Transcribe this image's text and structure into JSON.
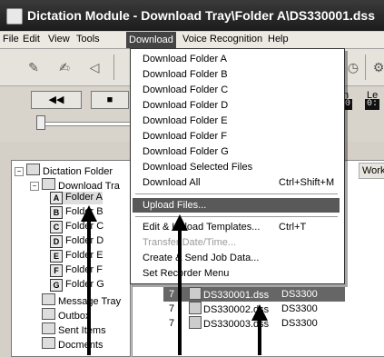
{
  "window": {
    "title": "Dictation Module - Download Tray\\Folder A\\DS330001.dss"
  },
  "menubar": {
    "items": [
      "File",
      "Edit",
      "View",
      "Tools",
      "Download",
      "Voice Recognition",
      "Help"
    ],
    "active": "Download"
  },
  "transport": {
    "rewind": "◀◀",
    "stop": "■",
    "label_on": "n",
    "label_le": "Le",
    "counter1": "0",
    "counter2": "0:"
  },
  "tree": {
    "root": "Dictation Folder",
    "download_tray": "Download Tra",
    "folders": [
      {
        "letter": "A",
        "label": "Folder A"
      },
      {
        "letter": "B",
        "label": "Folder B"
      },
      {
        "letter": "C",
        "label": "Folder C"
      },
      {
        "letter": "D",
        "label": "Folder D"
      },
      {
        "letter": "E",
        "label": "Folder E"
      },
      {
        "letter": "F",
        "label": "Folder F"
      },
      {
        "letter": "G",
        "label": "Folder G"
      }
    ],
    "message_tray": "Message Tray",
    "outbox": "Outbox",
    "sent_items": "Sent Items",
    "documents": "Docments"
  },
  "list": {
    "header_work": "Work",
    "rows": [
      {
        "col1": "7",
        "file": "DS330001.dss",
        "device": "DS3300"
      },
      {
        "col1": "7",
        "file": "DS330002.dss",
        "device": "DS3300"
      },
      {
        "col1": "7",
        "file": "DS330003.dss",
        "device": "DS3300"
      }
    ]
  },
  "download_menu": {
    "items": [
      {
        "label": "Download Folder A",
        "shortcut": ""
      },
      {
        "label": "Download Folder B",
        "shortcut": ""
      },
      {
        "label": "Download Folder C",
        "shortcut": ""
      },
      {
        "label": "Download Folder D",
        "shortcut": ""
      },
      {
        "label": "Download Folder E",
        "shortcut": ""
      },
      {
        "label": "Download Folder F",
        "shortcut": ""
      },
      {
        "label": "Download Folder G",
        "shortcut": ""
      },
      {
        "label": "Download Selected Files",
        "shortcut": ""
      },
      {
        "label": "Download All",
        "shortcut": "Ctrl+Shift+M"
      },
      {
        "label": "Upload Files...",
        "shortcut": ""
      },
      {
        "label": "Edit & Upload Templates...",
        "shortcut": "Ctrl+T"
      },
      {
        "label": "Transfer Date/Time...",
        "shortcut": ""
      },
      {
        "label": "Create & Send Job Data...",
        "shortcut": ""
      },
      {
        "label": "Set Recorder Menu",
        "shortcut": ""
      }
    ],
    "highlighted": "Upload Files..."
  },
  "colors": {
    "highlight": "#595959",
    "titlebar": "#2a2a2a"
  }
}
